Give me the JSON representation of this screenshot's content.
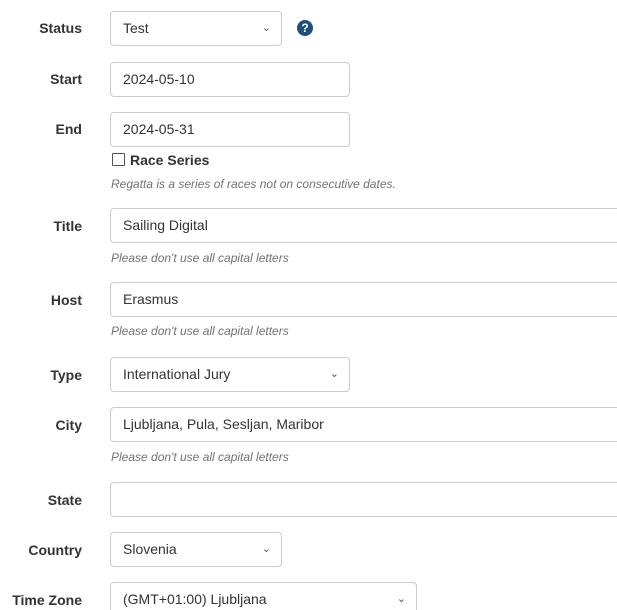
{
  "status": {
    "label": "Status",
    "value": "Test",
    "help_icon": "question-circle-icon"
  },
  "start": {
    "label": "Start",
    "value": "2024-05-10"
  },
  "end": {
    "label": "End",
    "value": "2024-05-31"
  },
  "race_series": {
    "label": "Race Series",
    "help": "Regatta is a series of races not on consecutive dates."
  },
  "title": {
    "label": "Title",
    "value": "Sailing Digital",
    "help": "Please don't use all capital letters"
  },
  "host": {
    "label": "Host",
    "value": "Erasmus",
    "help": "Please don't use all capital letters"
  },
  "type": {
    "label": "Type",
    "value": "International Jury"
  },
  "city": {
    "label": "City",
    "value": "Ljubljana, Pula, Sesljan, Maribor",
    "help": "Please don't use all capital letters"
  },
  "state": {
    "label": "State",
    "value": ""
  },
  "country": {
    "label": "Country",
    "value": "Slovenia"
  },
  "timezone": {
    "label": "Time Zone",
    "value": "(GMT+01:00) Ljubljana"
  },
  "icons": {
    "select_chevron": "chevron-down-icon",
    "checkbox": "unchecked-checkbox-icon"
  },
  "colors": {
    "help_icon": "#1f4e79",
    "help_text": "#737373",
    "border": "#cccccc"
  }
}
